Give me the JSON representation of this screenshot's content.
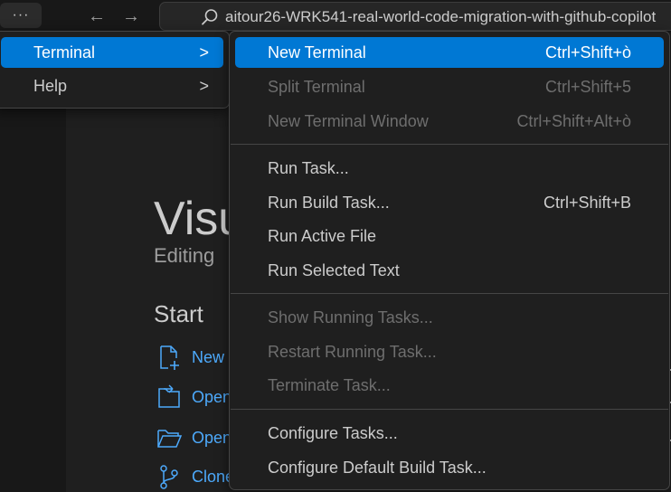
{
  "titlebar": {
    "more_label": "···",
    "back_arrow": "←",
    "forward_arrow": "→",
    "search_icon": "search-icon",
    "search_text": "aitour26-WRK541-real-world-code-migration-with-github-copilot"
  },
  "welcome": {
    "title": "Visu",
    "subtitle": "Editing",
    "start_heading": "Start",
    "items": [
      {
        "label": "New",
        "icon": "new-file-icon"
      },
      {
        "label": "Open",
        "icon": "open-file-icon"
      },
      {
        "label": "Open",
        "icon": "open-folder-icon"
      },
      {
        "label": "Clone",
        "icon": "clone-repo-icon"
      }
    ]
  },
  "menubar_menu": {
    "items": [
      {
        "label": "Terminal",
        "chevron": ">",
        "selected": true
      },
      {
        "label": "Help",
        "chevron": ">",
        "selected": false
      }
    ]
  },
  "terminal_menu": {
    "groups": [
      [
        {
          "label": "New Terminal",
          "shortcut": "Ctrl+Shift+ò",
          "state": "selected"
        },
        {
          "label": "Split Terminal",
          "shortcut": "Ctrl+Shift+5",
          "state": "disabled"
        },
        {
          "label": "New Terminal Window",
          "shortcut": "Ctrl+Shift+Alt+ò",
          "state": "disabled"
        }
      ],
      [
        {
          "label": "Run Task...",
          "shortcut": "",
          "state": "enabled"
        },
        {
          "label": "Run Build Task...",
          "shortcut": "Ctrl+Shift+B",
          "state": "enabled"
        },
        {
          "label": "Run Active File",
          "shortcut": "",
          "state": "enabled"
        },
        {
          "label": "Run Selected Text",
          "shortcut": "",
          "state": "enabled"
        }
      ],
      [
        {
          "label": "Show Running Tasks...",
          "shortcut": "",
          "state": "disabled"
        },
        {
          "label": "Restart Running Task...",
          "shortcut": "",
          "state": "disabled"
        },
        {
          "label": "Terminate Task...",
          "shortcut": "",
          "state": "disabled"
        }
      ],
      [
        {
          "label": "Configure Tasks...",
          "shortcut": "",
          "state": "enabled"
        },
        {
          "label": "Configure Default Build Task...",
          "shortcut": "",
          "state": "enabled"
        }
      ]
    ]
  },
  "colors": {
    "selection": "#0078d4",
    "link": "#4daafc",
    "disabled_text": "#6e6e6e"
  }
}
